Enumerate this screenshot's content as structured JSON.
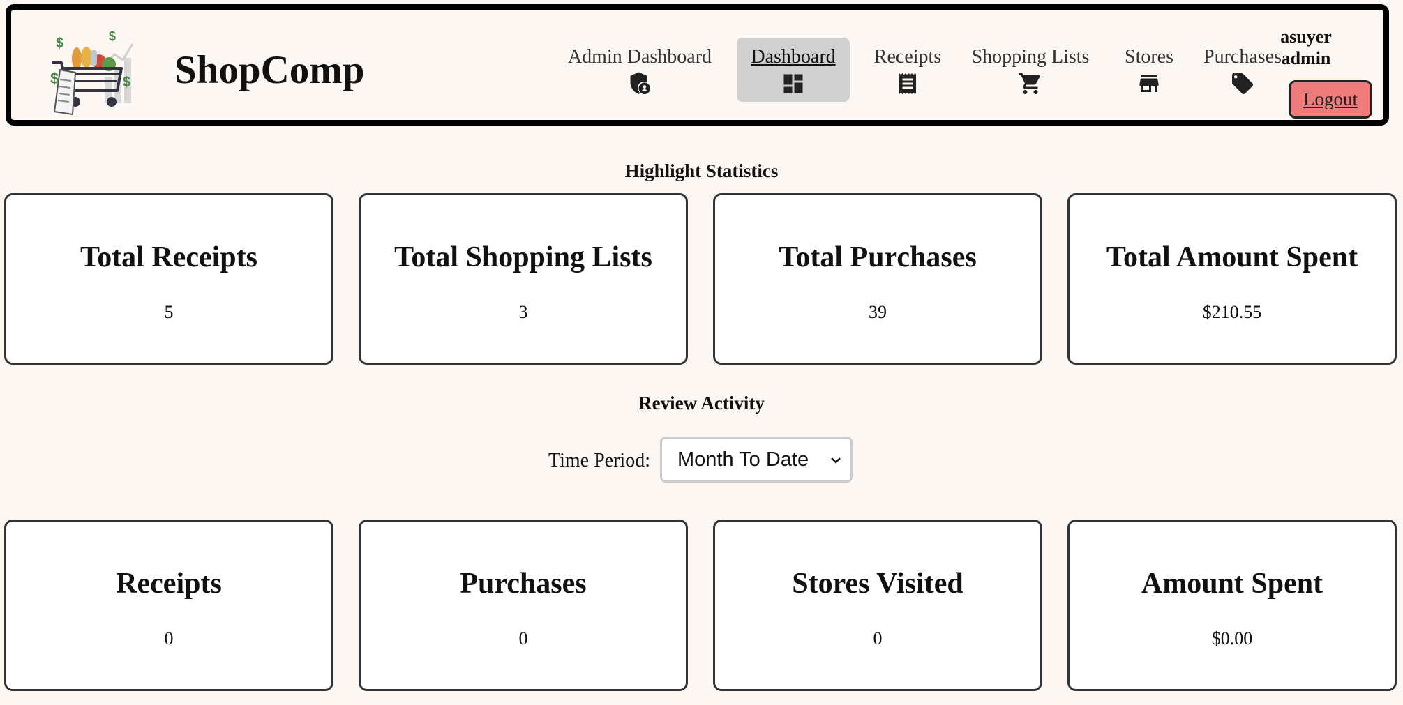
{
  "header": {
    "brand": "ShopComp",
    "logo_icon": "shopping-cart-logo-icon",
    "nav": [
      {
        "label": "Admin Dashboard",
        "icon": "admin-shield-icon",
        "active": false
      },
      {
        "label": "Dashboard",
        "icon": "dashboard-icon",
        "active": true
      },
      {
        "label": "Receipts",
        "icon": "receipt-icon",
        "active": false
      },
      {
        "label": "Shopping Lists",
        "icon": "shopping-cart-icon",
        "active": false
      },
      {
        "label": "Stores",
        "icon": "store-icon",
        "active": false
      },
      {
        "label": "Purchases",
        "icon": "tag-icon",
        "active": false
      }
    ],
    "user": {
      "name": "asuyer",
      "role": "admin"
    },
    "logout_label": "Logout"
  },
  "highlight": {
    "title": "Highlight Statistics",
    "cards": [
      {
        "title": "Total Receipts",
        "value": "5"
      },
      {
        "title": "Total Shopping Lists",
        "value": "3"
      },
      {
        "title": "Total Purchases",
        "value": "39"
      },
      {
        "title": "Total Amount Spent",
        "value": "$210.55"
      }
    ]
  },
  "review": {
    "title": "Review Activity",
    "period_label": "Time Period:",
    "period_value": "Month To Date",
    "cards": [
      {
        "title": "Receipts",
        "value": "0"
      },
      {
        "title": "Purchases",
        "value": "0"
      },
      {
        "title": "Stores Visited",
        "value": "0"
      },
      {
        "title": "Amount Spent",
        "value": "$0.00"
      }
    ]
  },
  "colors": {
    "background": "#fcf7f2",
    "active_nav": "#d0d0d0",
    "logout": "#f07b7b"
  }
}
